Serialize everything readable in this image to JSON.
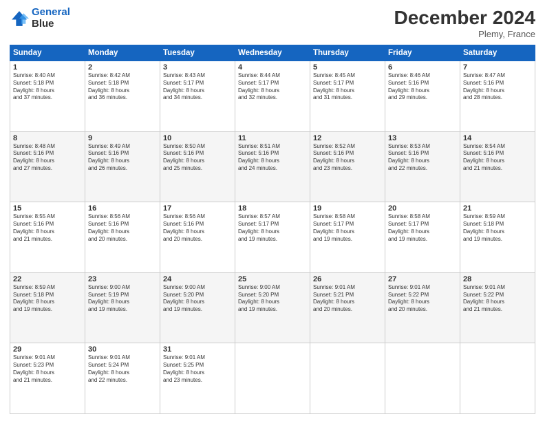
{
  "header": {
    "logo_line1": "General",
    "logo_line2": "Blue",
    "main_title": "December 2024",
    "subtitle": "Plemy, France"
  },
  "columns": [
    "Sunday",
    "Monday",
    "Tuesday",
    "Wednesday",
    "Thursday",
    "Friday",
    "Saturday"
  ],
  "weeks": [
    [
      {
        "day": "1",
        "lines": [
          "Sunrise: 8:40 AM",
          "Sunset: 5:18 PM",
          "Daylight: 8 hours",
          "and 37 minutes."
        ]
      },
      {
        "day": "2",
        "lines": [
          "Sunrise: 8:42 AM",
          "Sunset: 5:18 PM",
          "Daylight: 8 hours",
          "and 36 minutes."
        ]
      },
      {
        "day": "3",
        "lines": [
          "Sunrise: 8:43 AM",
          "Sunset: 5:17 PM",
          "Daylight: 8 hours",
          "and 34 minutes."
        ]
      },
      {
        "day": "4",
        "lines": [
          "Sunrise: 8:44 AM",
          "Sunset: 5:17 PM",
          "Daylight: 8 hours",
          "and 32 minutes."
        ]
      },
      {
        "day": "5",
        "lines": [
          "Sunrise: 8:45 AM",
          "Sunset: 5:17 PM",
          "Daylight: 8 hours",
          "and 31 minutes."
        ]
      },
      {
        "day": "6",
        "lines": [
          "Sunrise: 8:46 AM",
          "Sunset: 5:16 PM",
          "Daylight: 8 hours",
          "and 29 minutes."
        ]
      },
      {
        "day": "7",
        "lines": [
          "Sunrise: 8:47 AM",
          "Sunset: 5:16 PM",
          "Daylight: 8 hours",
          "and 28 minutes."
        ]
      }
    ],
    [
      {
        "day": "8",
        "lines": [
          "Sunrise: 8:48 AM",
          "Sunset: 5:16 PM",
          "Daylight: 8 hours",
          "and 27 minutes."
        ]
      },
      {
        "day": "9",
        "lines": [
          "Sunrise: 8:49 AM",
          "Sunset: 5:16 PM",
          "Daylight: 8 hours",
          "and 26 minutes."
        ]
      },
      {
        "day": "10",
        "lines": [
          "Sunrise: 8:50 AM",
          "Sunset: 5:16 PM",
          "Daylight: 8 hours",
          "and 25 minutes."
        ]
      },
      {
        "day": "11",
        "lines": [
          "Sunrise: 8:51 AM",
          "Sunset: 5:16 PM",
          "Daylight: 8 hours",
          "and 24 minutes."
        ]
      },
      {
        "day": "12",
        "lines": [
          "Sunrise: 8:52 AM",
          "Sunset: 5:16 PM",
          "Daylight: 8 hours",
          "and 23 minutes."
        ]
      },
      {
        "day": "13",
        "lines": [
          "Sunrise: 8:53 AM",
          "Sunset: 5:16 PM",
          "Daylight: 8 hours",
          "and 22 minutes."
        ]
      },
      {
        "day": "14",
        "lines": [
          "Sunrise: 8:54 AM",
          "Sunset: 5:16 PM",
          "Daylight: 8 hours",
          "and 21 minutes."
        ]
      }
    ],
    [
      {
        "day": "15",
        "lines": [
          "Sunrise: 8:55 AM",
          "Sunset: 5:16 PM",
          "Daylight: 8 hours",
          "and 21 minutes."
        ]
      },
      {
        "day": "16",
        "lines": [
          "Sunrise: 8:56 AM",
          "Sunset: 5:16 PM",
          "Daylight: 8 hours",
          "and 20 minutes."
        ]
      },
      {
        "day": "17",
        "lines": [
          "Sunrise: 8:56 AM",
          "Sunset: 5:16 PM",
          "Daylight: 8 hours",
          "and 20 minutes."
        ]
      },
      {
        "day": "18",
        "lines": [
          "Sunrise: 8:57 AM",
          "Sunset: 5:17 PM",
          "Daylight: 8 hours",
          "and 19 minutes."
        ]
      },
      {
        "day": "19",
        "lines": [
          "Sunrise: 8:58 AM",
          "Sunset: 5:17 PM",
          "Daylight: 8 hours",
          "and 19 minutes."
        ]
      },
      {
        "day": "20",
        "lines": [
          "Sunrise: 8:58 AM",
          "Sunset: 5:17 PM",
          "Daylight: 8 hours",
          "and 19 minutes."
        ]
      },
      {
        "day": "21",
        "lines": [
          "Sunrise: 8:59 AM",
          "Sunset: 5:18 PM",
          "Daylight: 8 hours",
          "and 19 minutes."
        ]
      }
    ],
    [
      {
        "day": "22",
        "lines": [
          "Sunrise: 8:59 AM",
          "Sunset: 5:18 PM",
          "Daylight: 8 hours",
          "and 19 minutes."
        ]
      },
      {
        "day": "23",
        "lines": [
          "Sunrise: 9:00 AM",
          "Sunset: 5:19 PM",
          "Daylight: 8 hours",
          "and 19 minutes."
        ]
      },
      {
        "day": "24",
        "lines": [
          "Sunrise: 9:00 AM",
          "Sunset: 5:20 PM",
          "Daylight: 8 hours",
          "and 19 minutes."
        ]
      },
      {
        "day": "25",
        "lines": [
          "Sunrise: 9:00 AM",
          "Sunset: 5:20 PM",
          "Daylight: 8 hours",
          "and 19 minutes."
        ]
      },
      {
        "day": "26",
        "lines": [
          "Sunrise: 9:01 AM",
          "Sunset: 5:21 PM",
          "Daylight: 8 hours",
          "and 20 minutes."
        ]
      },
      {
        "day": "27",
        "lines": [
          "Sunrise: 9:01 AM",
          "Sunset: 5:22 PM",
          "Daylight: 8 hours",
          "and 20 minutes."
        ]
      },
      {
        "day": "28",
        "lines": [
          "Sunrise: 9:01 AM",
          "Sunset: 5:22 PM",
          "Daylight: 8 hours",
          "and 21 minutes."
        ]
      }
    ],
    [
      {
        "day": "29",
        "lines": [
          "Sunrise: 9:01 AM",
          "Sunset: 5:23 PM",
          "Daylight: 8 hours",
          "and 21 minutes."
        ]
      },
      {
        "day": "30",
        "lines": [
          "Sunrise: 9:01 AM",
          "Sunset: 5:24 PM",
          "Daylight: 8 hours",
          "and 22 minutes."
        ]
      },
      {
        "day": "31",
        "lines": [
          "Sunrise: 9:01 AM",
          "Sunset: 5:25 PM",
          "Daylight: 8 hours",
          "and 23 minutes."
        ]
      },
      null,
      null,
      null,
      null
    ]
  ]
}
